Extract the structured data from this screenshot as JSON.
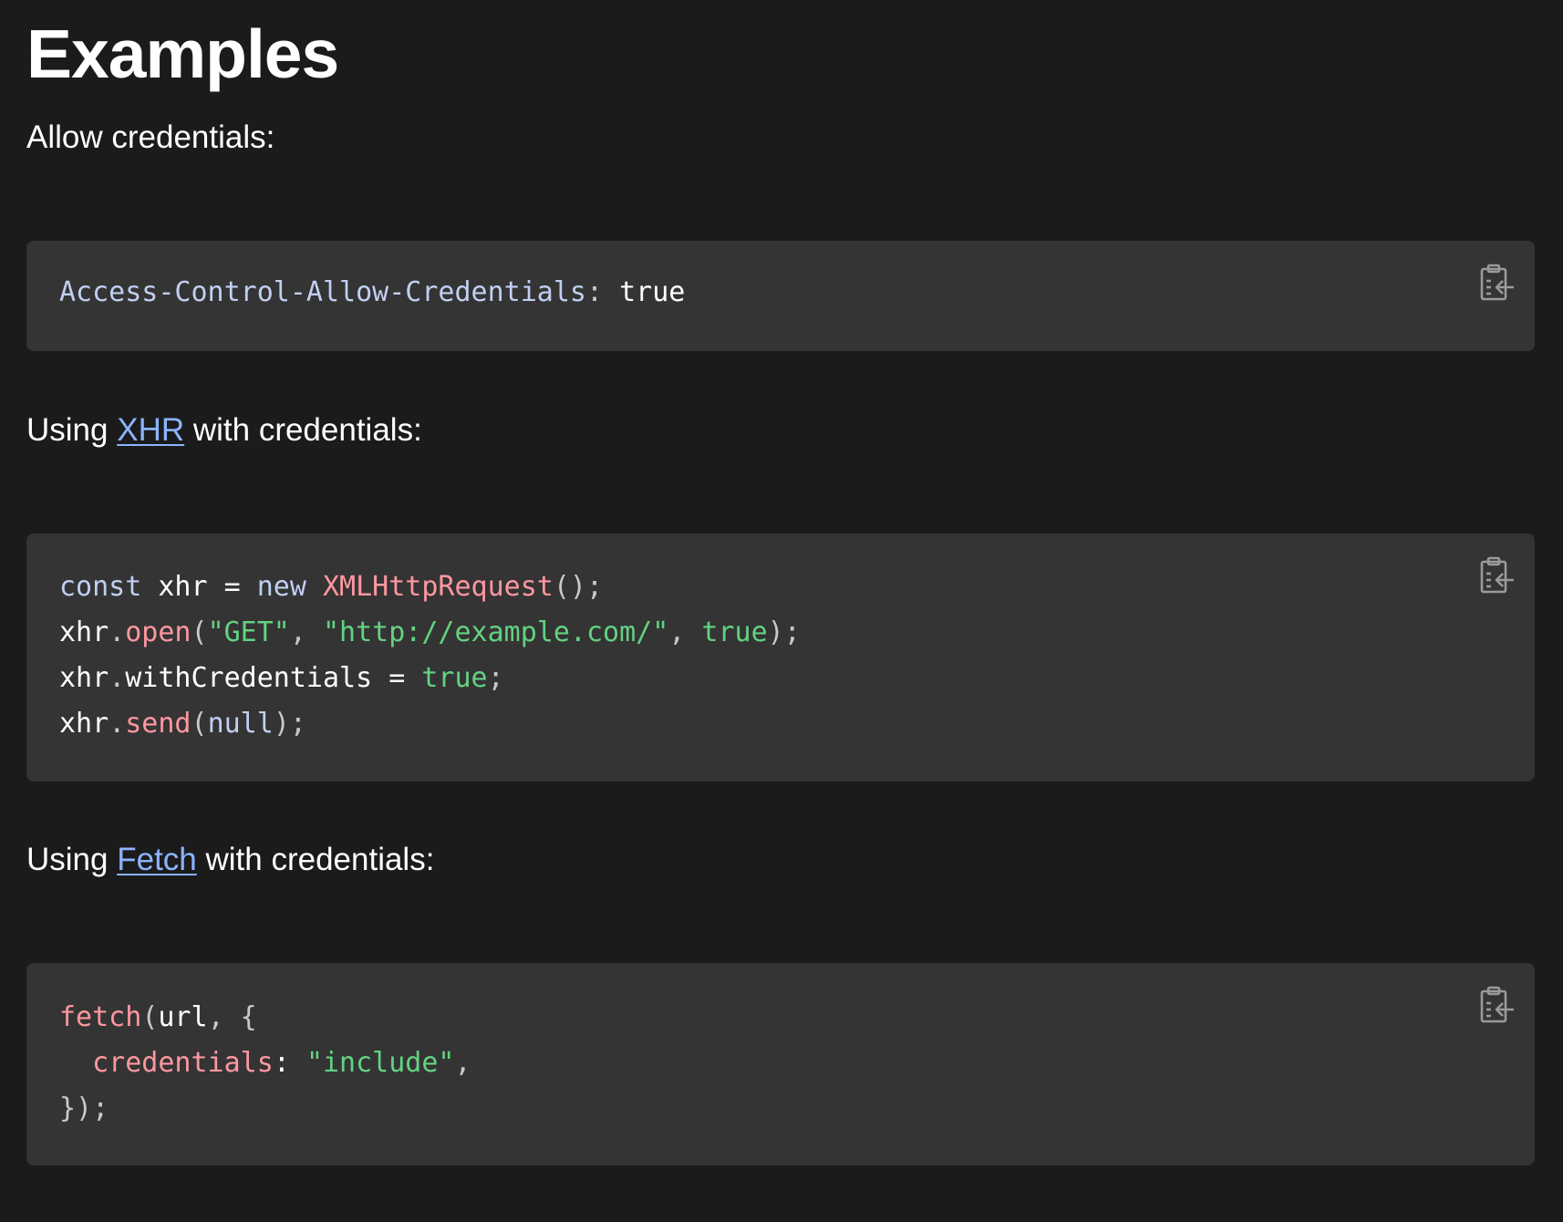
{
  "heading": "Examples",
  "sections": [
    {
      "intro": "Allow credentials:",
      "code_lines": [
        [
          [
            "tk-hname",
            "Access-Control-Allow-Credentials"
          ],
          [
            "tk-punc",
            ":"
          ],
          [
            "tk-id",
            " true"
          ]
        ]
      ]
    },
    {
      "intro_before": "Using ",
      "intro_link": "XHR",
      "intro_after": " with credentials:",
      "code_lines": [
        [
          [
            "tk-kw",
            "const"
          ],
          [
            "tk-id",
            " xhr "
          ],
          [
            "tk-id",
            "="
          ],
          [
            "tk-id",
            " "
          ],
          [
            "tk-kw",
            "new"
          ],
          [
            "tk-id",
            " "
          ],
          [
            "tk-fn",
            "XMLHttpRequest"
          ],
          [
            "tk-punc",
            "();"
          ]
        ],
        [
          [
            "tk-id",
            "xhr"
          ],
          [
            "tk-punc",
            "."
          ],
          [
            "tk-fn",
            "open"
          ],
          [
            "tk-punc",
            "("
          ],
          [
            "tk-str",
            "\"GET\""
          ],
          [
            "tk-punc",
            ", "
          ],
          [
            "tk-str",
            "\"http://example.com/\""
          ],
          [
            "tk-punc",
            ", "
          ],
          [
            "tk-bool",
            "true"
          ],
          [
            "tk-punc",
            ");"
          ]
        ],
        [
          [
            "tk-id",
            "xhr"
          ],
          [
            "tk-punc",
            "."
          ],
          [
            "tk-id",
            "withCredentials "
          ],
          [
            "tk-id",
            "="
          ],
          [
            "tk-id",
            " "
          ],
          [
            "tk-bool",
            "true"
          ],
          [
            "tk-punc",
            ";"
          ]
        ],
        [
          [
            "tk-id",
            "xhr"
          ],
          [
            "tk-punc",
            "."
          ],
          [
            "tk-fn",
            "send"
          ],
          [
            "tk-punc",
            "("
          ],
          [
            "tk-kw",
            "null"
          ],
          [
            "tk-punc",
            ");"
          ]
        ]
      ]
    },
    {
      "intro_before": "Using ",
      "intro_link": "Fetch",
      "intro_after": " with credentials:",
      "code_lines": [
        [
          [
            "tk-fn",
            "fetch"
          ],
          [
            "tk-punc",
            "("
          ],
          [
            "tk-id",
            "url"
          ],
          [
            "tk-punc",
            ", {"
          ]
        ],
        [
          [
            "tk-id",
            "  "
          ],
          [
            "tk-prop",
            "credentials"
          ],
          [
            "tk-id",
            ":"
          ],
          [
            "tk-id",
            " "
          ],
          [
            "tk-str",
            "\"include\""
          ],
          [
            "tk-punc",
            ","
          ]
        ],
        [
          [
            "tk-punc",
            "});"
          ]
        ]
      ]
    }
  ],
  "copy_icon": "clipboard-copy-icon",
  "colors": {
    "background": "#1b1b1b",
    "code_background": "#343434",
    "link": "#8cb4ff",
    "keyword": "#c1cff1",
    "function": "#ff97a0",
    "string": "#63d282"
  }
}
